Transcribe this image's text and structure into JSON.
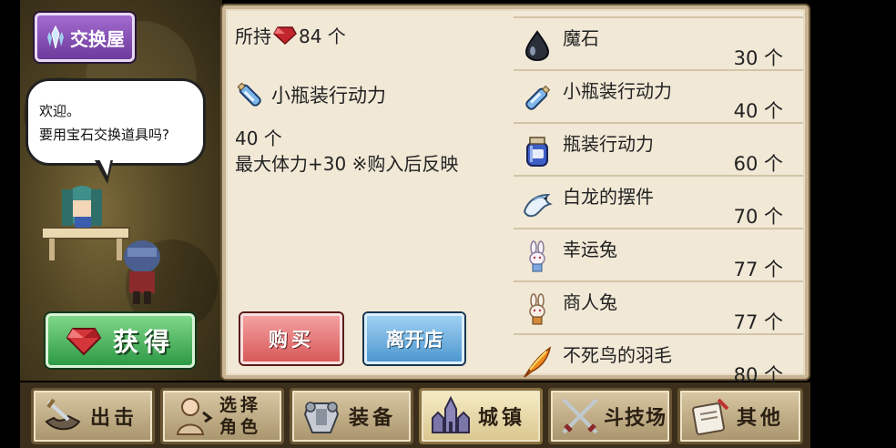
{
  "shop": {
    "title": "交换屋",
    "greeting_line1": "欢迎。",
    "greeting_line2": "要用宝石交换道具吗?",
    "get_label": "获得"
  },
  "detail": {
    "owned_prefix": "所持",
    "owned_amount": "84 个",
    "item_name": "小瓶装行动力",
    "item_count": "40 个",
    "item_desc": "最大体力+30 ※购入后反映"
  },
  "actions": {
    "buy_label": "购买",
    "leave_label": "离开店"
  },
  "items": [
    {
      "name": "魔石",
      "price": "30 个",
      "icon": "magic-stone-icon"
    },
    {
      "name": "小瓶装行动力",
      "price": "40 个",
      "icon": "small-bottle-icon"
    },
    {
      "name": "瓶装行动力",
      "price": "60 个",
      "icon": "jar-icon"
    },
    {
      "name": "白龙的摆件",
      "price": "70 个",
      "icon": "white-dragon-icon"
    },
    {
      "name": "幸运兔",
      "price": "77 个",
      "icon": "lucky-rabbit-icon"
    },
    {
      "name": "商人兔",
      "price": "77 个",
      "icon": "merchant-rabbit-icon"
    },
    {
      "name": "不死鸟的羽毛",
      "price": "80 个",
      "icon": "phoenix-feather-icon"
    }
  ],
  "nav": [
    {
      "label": "出击",
      "icon": "sortie-icon"
    },
    {
      "label_line1": "选择",
      "label_line2": "角色",
      "icon": "character-icon"
    },
    {
      "label": "装备",
      "icon": "equipment-icon"
    },
    {
      "label": "城镇",
      "icon": "town-icon",
      "active": true
    },
    {
      "label": "斗技场",
      "icon": "arena-icon"
    },
    {
      "label": "其他",
      "icon": "other-icon"
    }
  ],
  "colors": {
    "panel": "#f1e8d6",
    "buy": "#d85a5a",
    "leave": "#4f98d0",
    "get": "#2e9a45",
    "shop_badge": "#6c3b9a",
    "gem": "#c0262b"
  }
}
